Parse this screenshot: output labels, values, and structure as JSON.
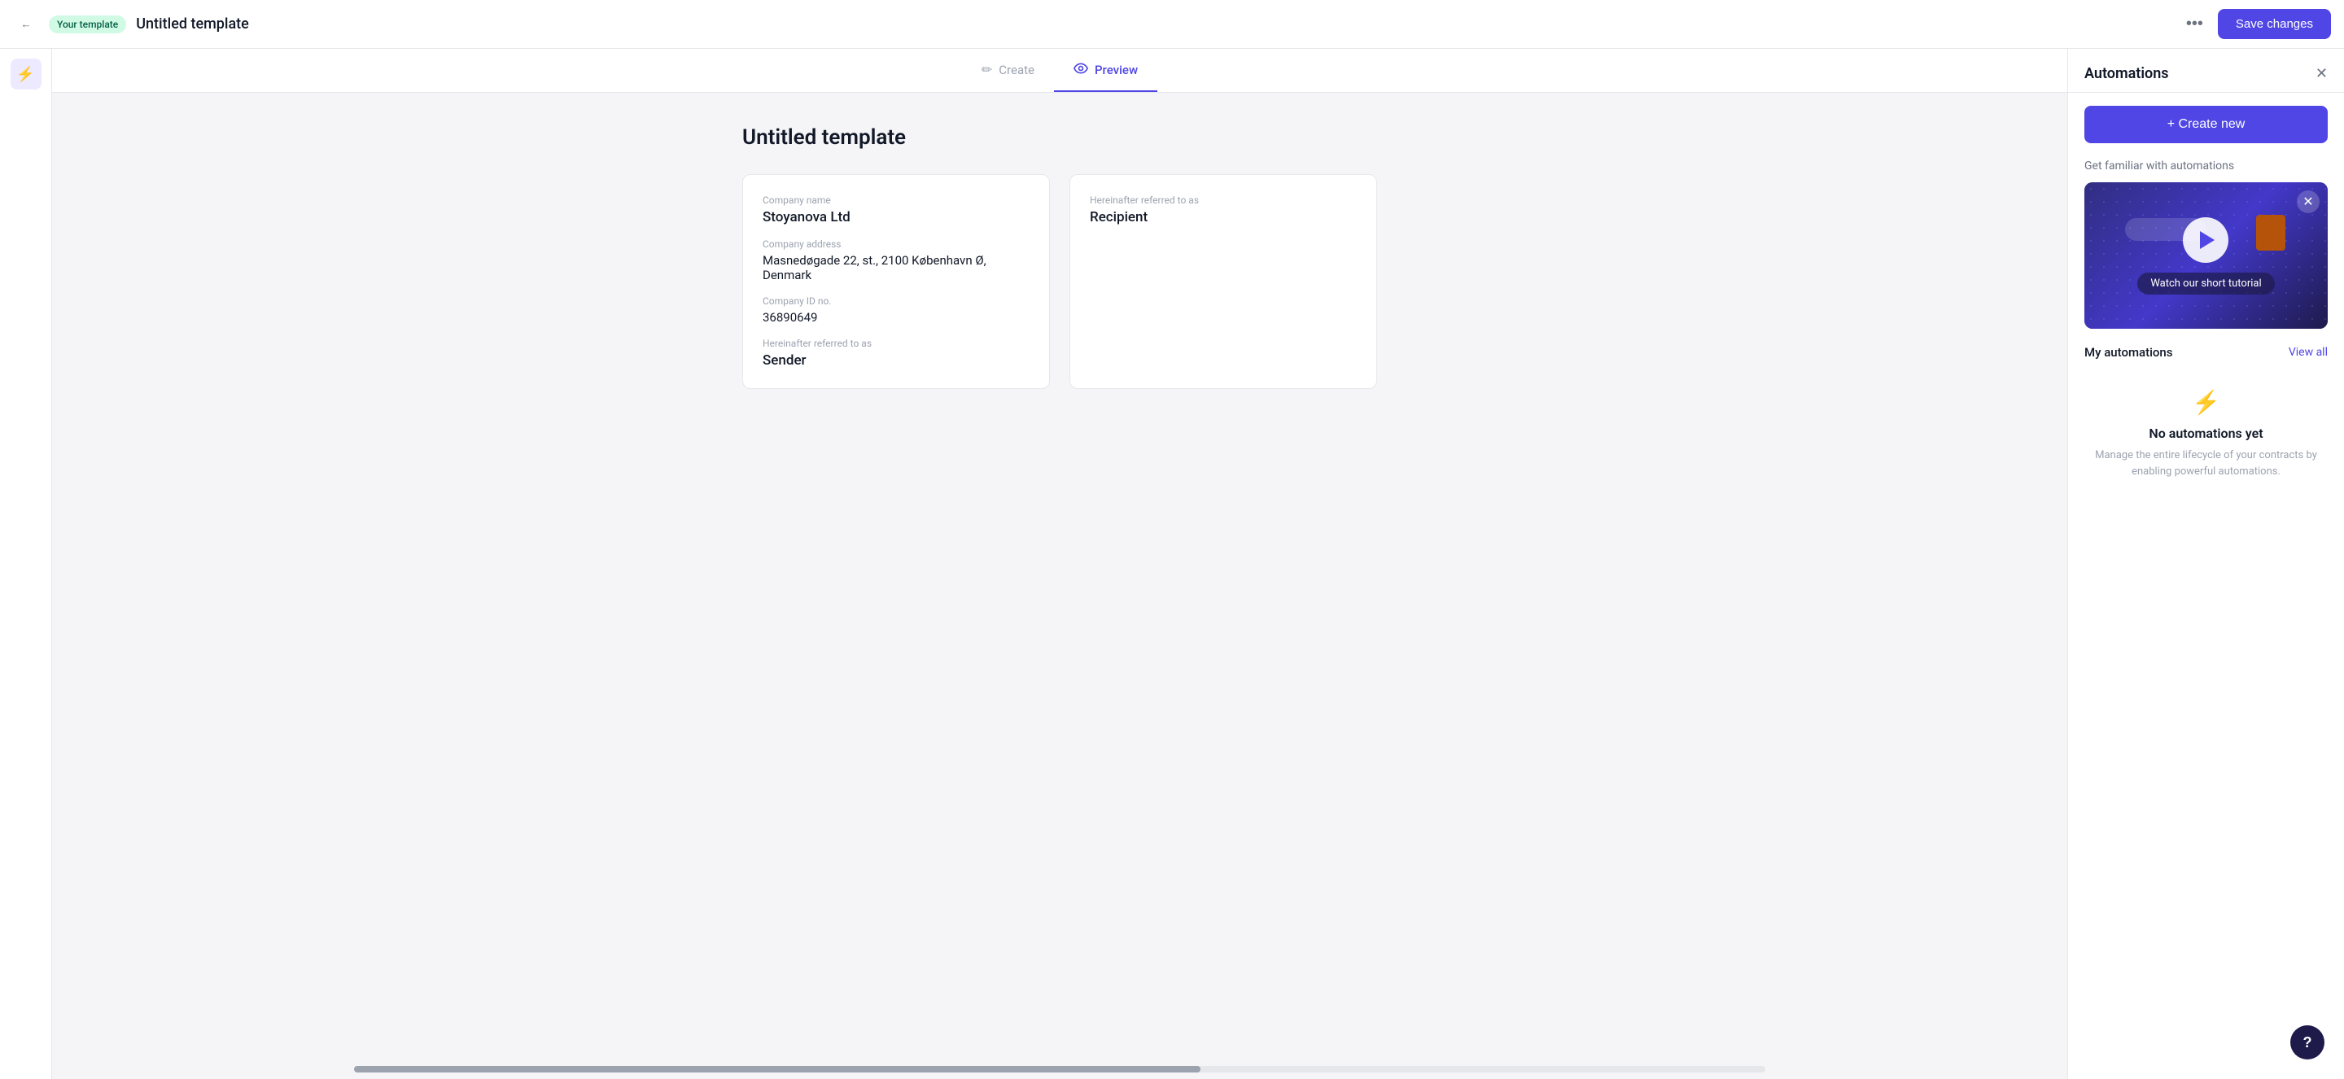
{
  "topbar": {
    "back_icon": "←",
    "badge_label": "Your template",
    "title": "Untitled template",
    "more_icon": "•••",
    "save_label": "Save changes"
  },
  "tabs": [
    {
      "id": "create",
      "label": "Create",
      "icon": "✏",
      "active": false
    },
    {
      "id": "preview",
      "label": "Preview",
      "icon": "👁",
      "active": true
    }
  ],
  "document": {
    "title": "Untitled template",
    "sender_card": {
      "company_name_label": "Company name",
      "company_name_value": "Stoyanova Ltd",
      "company_address_label": "Company address",
      "company_address_value": "Masnedøgade 22, st., 2100 København Ø, Denmark",
      "company_id_label": "Company ID no.",
      "company_id_value": "36890649",
      "referred_as_label": "Hereinafter referred to as",
      "referred_as_value": "Sender"
    },
    "recipient_card": {
      "referred_as_label": "Hereinafter referred to as",
      "referred_as_value": "Recipient"
    }
  },
  "panel": {
    "title": "Automations",
    "close_icon": "✕",
    "create_new_label": "+ Create new",
    "familiar_title": "Get familiar with automations",
    "video_close_icon": "✕",
    "watch_label": "Watch our short tutorial",
    "my_automations_label": "My automations",
    "view_all_label": "View all",
    "no_auto_title": "No automations yet",
    "no_auto_desc": "Manage the entire lifecycle of your contracts by enabling powerful automations."
  },
  "help": {
    "label": "?"
  }
}
